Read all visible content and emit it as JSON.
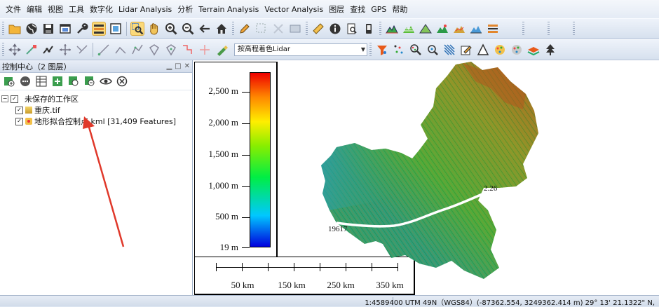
{
  "menu": [
    "文件",
    "编辑",
    "视图",
    "工具",
    "数字化",
    "Lidar Analysis",
    "分析",
    "Terrain Analysis",
    "Vector Analysis",
    "图层",
    "查找",
    "GPS",
    "帮助"
  ],
  "toolbar2": {
    "color_scheme": "按高程着色Lidar"
  },
  "panel": {
    "title": "控制中心（2 图层）",
    "tree": {
      "workspace": "未保存的工作区",
      "layers": [
        "重庆.tif",
        "地形拟合控制点.kml [31,409 Features]"
      ]
    }
  },
  "legend": {
    "labels": [
      "2,500 m",
      "2,000 m",
      "1,500 m",
      "1,000 m",
      "500 m",
      "19 m"
    ]
  },
  "scalebar": {
    "labels": [
      "50 km",
      "150 km",
      "250 km",
      "350 km"
    ]
  },
  "map_labels": [
    "19617",
    "2.26"
  ],
  "status": {
    "text": "1:4589400 UTM 49N（WGS84）(-87362.554, 3249362.414 m) 29° 13' 21.1322\" N,"
  },
  "colors": {
    "menu_bg": "#e4ebf5",
    "toolbar_bg": "#d6e0ee",
    "active_tool": "#fbd97a"
  },
  "icons": {
    "toolbar1": [
      "folder-open-icon",
      "globe-icon",
      "save-icon",
      "window-icon",
      "wrench-icon",
      "layers-icon",
      "frame-icon",
      "zoom-select-icon",
      "pan-hand-icon",
      "zoom-in-icon",
      "zoom-out-icon",
      "back-arrow-icon",
      "home-icon",
      "pencil-icon",
      "select-rect-icon",
      "delete-icon",
      "measure-icon",
      "ruler-icon",
      "info-icon",
      "find-icon",
      "phone-icon",
      "terrain1-icon",
      "terrain2-icon",
      "terrain3-icon",
      "terrain4-icon",
      "terrain5-icon",
      "terrain6-icon",
      "terrain7-icon"
    ],
    "toolbar2": [
      "move-icon",
      "vertex-icon",
      "edit-vertex-icon",
      "crosshair-icon",
      "cut-icon",
      "line-icon",
      "line2-icon",
      "feature-icon",
      "feature2-icon",
      "feature3-icon",
      "feature4-icon",
      "feature5-icon",
      "brush-icon",
      "filter-icon",
      "dots-icon",
      "zoom-pts-icon",
      "zoom-pts2-icon",
      "grid-icon",
      "edit-layer-icon",
      "triangle-icon",
      "points-icon",
      "points2-icon",
      "layers2-icon",
      "tree-icon"
    ]
  }
}
